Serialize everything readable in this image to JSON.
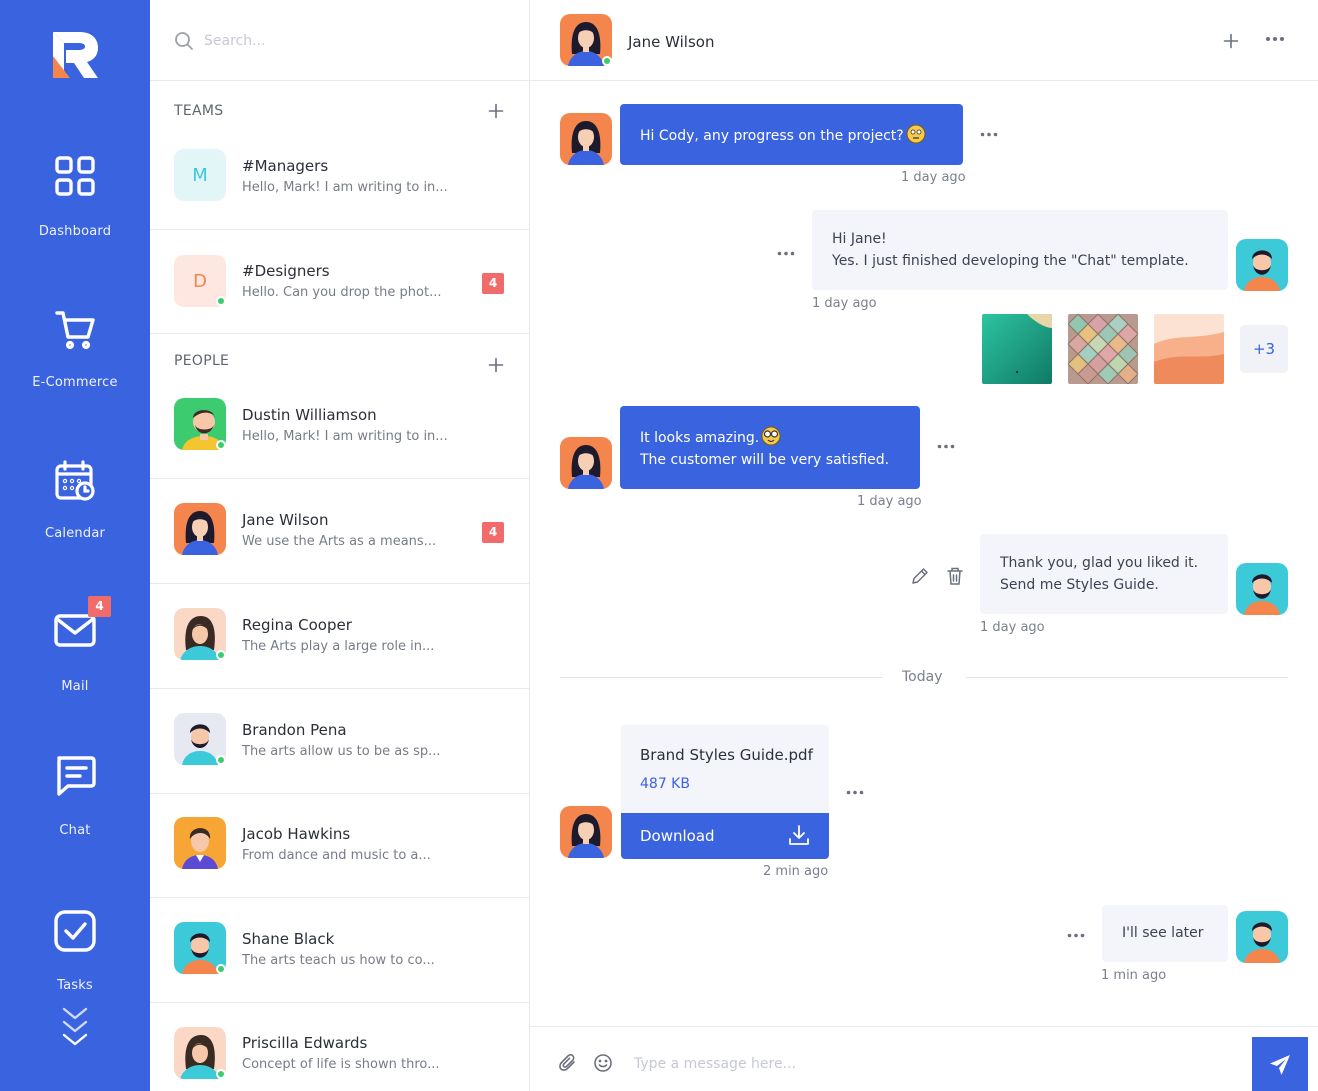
{
  "nav": {
    "items": [
      {
        "label": "Dashboard",
        "icon": "dashboard-grid-icon"
      },
      {
        "label": "E-Commerce",
        "icon": "cart-icon"
      },
      {
        "label": "Calendar",
        "icon": "calendar-icon"
      },
      {
        "label": "Mail",
        "icon": "mail-icon",
        "badge": "4"
      },
      {
        "label": "Chat",
        "icon": "chat-icon"
      },
      {
        "label": "Tasks",
        "icon": "tasks-check-icon"
      }
    ],
    "accent": "#3a63e0"
  },
  "search": {
    "placeholder": "Search..."
  },
  "teams": {
    "title": "TEAMS",
    "items": [
      {
        "letter": "M",
        "name": "#Managers",
        "preview": "Hello, Mark! I am writing to in...",
        "online": false,
        "badge": ""
      },
      {
        "letter": "D",
        "name": "#Designers",
        "preview": "Hello. Can you drop the phot...",
        "online": true,
        "badge": "4"
      }
    ]
  },
  "people": {
    "title": "PEOPLE",
    "items": [
      {
        "name": "Dustin Williamson",
        "preview": "Hello, Mark! I am writing to in...",
        "online": true,
        "badge": ""
      },
      {
        "name": "Jane Wilson",
        "preview": "We use the Arts as a means...",
        "online": false,
        "badge": "4"
      },
      {
        "name": "Regina Cooper",
        "preview": "The Arts play a large role in...",
        "online": true,
        "badge": ""
      },
      {
        "name": "Brandon Pena",
        "preview": "The arts allow us to be as sp...",
        "online": true,
        "badge": ""
      },
      {
        "name": "Jacob Hawkins",
        "preview": "From dance and music to a...",
        "online": false,
        "badge": ""
      },
      {
        "name": "Shane Black",
        "preview": "The arts teach us how to co...",
        "online": true,
        "badge": ""
      },
      {
        "name": "Priscilla Edwards",
        "preview": "Concept of life is shown thro...",
        "online": true,
        "badge": ""
      }
    ]
  },
  "chat": {
    "contact_name": "Jane Wilson",
    "messages": [
      {
        "from": "Jane Wilson",
        "text": "Hi Cody, any progress on the project?",
        "time": "1 day ago"
      },
      {
        "from": "me",
        "line1": "Hi Jane!",
        "line2": "Yes. I just finished developing the \"Chat\" template.",
        "time": "1 day ago"
      },
      {
        "from": "me",
        "attachments_extra": "+3"
      },
      {
        "from": "Jane Wilson",
        "line1": "It looks amazing.",
        "line2": "The customer will be very satisfied.",
        "time": "1 day ago"
      },
      {
        "from": "me",
        "line1": "Thank you, glad you liked it.",
        "line2": "Send me Styles Guide.",
        "time": "1 day ago"
      },
      {
        "from": "Jane Wilson",
        "file_name": "Brand Styles Guide.pdf",
        "file_size": "487 KB",
        "download_label": "Download",
        "time": "2 min ago"
      },
      {
        "from": "me",
        "text": "I'll see later",
        "time": "1 min ago"
      }
    ],
    "divider": "Today",
    "composer_placeholder": "Type a message here..."
  }
}
